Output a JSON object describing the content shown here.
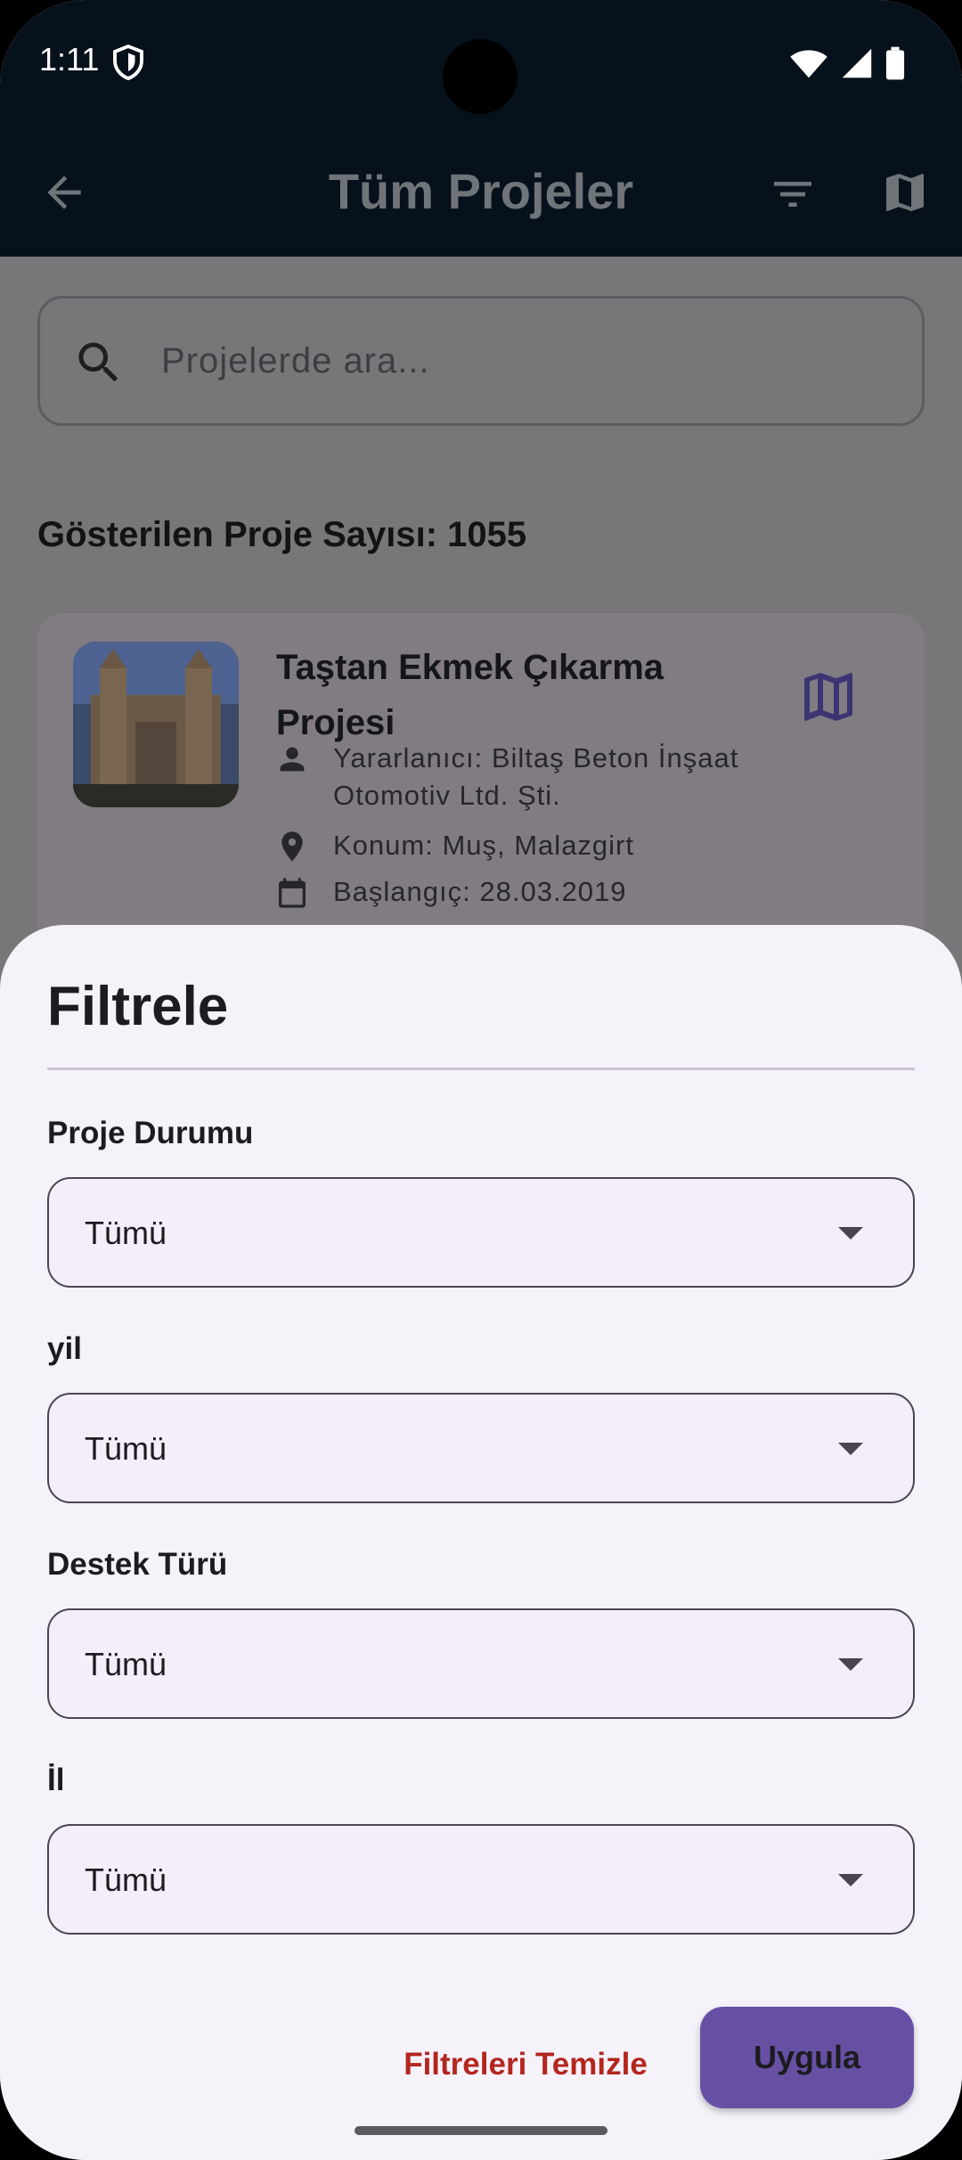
{
  "status_bar": {
    "time": "1:11",
    "icons": [
      "shield-icon",
      "wifi-icon",
      "signal-icon",
      "battery-icon"
    ]
  },
  "app_bar": {
    "title": "Tüm Projeler",
    "icons": [
      "back-arrow-icon",
      "filter-list-icon",
      "map-icon"
    ]
  },
  "search": {
    "placeholder": "Projelerde ara..."
  },
  "count_label": "Gösterilen Proje Sayısı: 1055",
  "project_card": {
    "title": "Taştan Ekmek Çıkarma Projesi",
    "beneficiary": "Yararlanıcı: Biltaş Beton İnşaat Otomotiv Ltd. Şti.",
    "location": "Konum: Muş, Malazgirt",
    "date_partial": "Başlangıç: 28.03.2019"
  },
  "filter_sheet": {
    "title": "Filtrele",
    "fields": [
      {
        "label": "Proje Durumu",
        "value": "Tümü"
      },
      {
        "label": "yil",
        "value": "Tümü"
      },
      {
        "label": "Destek Türü",
        "value": "Tümü"
      },
      {
        "label": "İl",
        "value": "Tümü"
      }
    ],
    "clear_label": "Filtreleri Temizle",
    "apply_label": "Uygula"
  },
  "colors": {
    "primary": "#6750a4",
    "danger": "#b3261e",
    "app_bar_bg": "#07111c",
    "sheet_bg": "#f6f2fa"
  }
}
